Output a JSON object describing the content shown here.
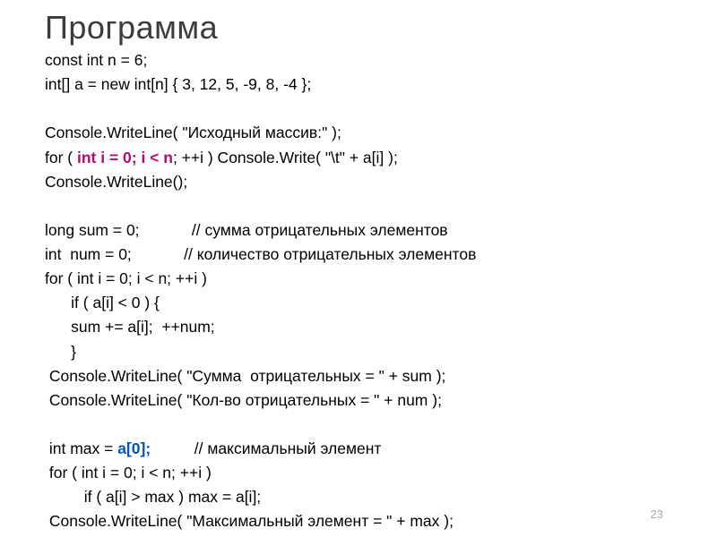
{
  "title": "Программа",
  "code": {
    "l1": "const int n = 6;",
    "l2": "int[] a = new int[n] { 3, 12, 5, -9, 8, -4 };",
    "l3": "",
    "l4": "Console.WriteLine( \"Исходный массив:\" );",
    "l5a": "for ( ",
    "l5b": "int i = 0; i < n",
    "l5c": "; ++i ) Console.Write( \"\\t\" + a[i] );",
    "l6": "Console.WriteLine();",
    "l7": "",
    "l8": "long sum = 0;            // сумма отрицательных элементов",
    "l9": "int  num = 0;            // количество отрицательных элементов",
    "l10": "for ( int i = 0; i < n; ++i )",
    "l11": "      if ( a[i] < 0 ) {",
    "l12": "      sum += a[i];  ++num;",
    "l13": "      }",
    "l14": " Console.WriteLine( \"Сумма  отрицательных = \" + sum );",
    "l15": " Console.WriteLine( \"Кол-во отрицательных = \" + num );",
    "l16": "",
    "l17a": " int max = ",
    "l17b": "a[0];",
    "l17c": "          // максимальный элемент",
    "l18": " for ( int i = 0; i < n; ++i )",
    "l19": "         if ( a[i] > max ) max = a[i];",
    "l20": " Console.WriteLine( \"Максимальный элемент = \" + max );"
  },
  "pagenum": "23"
}
